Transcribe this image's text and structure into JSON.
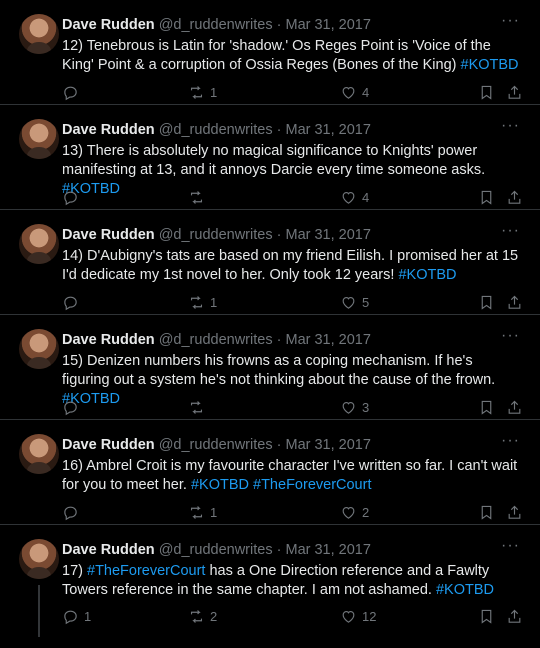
{
  "author": {
    "name": "Dave Rudden",
    "handle": "@d_ruddenwrites",
    "dot": "·",
    "date": "Mar 31, 2017"
  },
  "more_label": "···",
  "tweets": [
    {
      "segments": [
        {
          "t": "12) Tenebrous is Latin for 'shadow.' Os Reges Point is 'Voice of the King' Point & a corruption of Ossia Reges (Bones of the King) "
        },
        {
          "t": "#KOTBD",
          "tag": true
        }
      ],
      "replies": "",
      "retweets": "1",
      "likes": "4"
    },
    {
      "segments": [
        {
          "t": "13) There is absolutely no magical significance to Knights' power manifesting at 13, and it annoys Darcie every time someone asks. "
        },
        {
          "t": "#KOTBD",
          "tag": true
        }
      ],
      "replies": "",
      "retweets": "",
      "likes": "4"
    },
    {
      "segments": [
        {
          "t": "14) D'Aubigny's tats are based on my friend Eilish. I promised her at 15 I'd dedicate my 1st novel to her. Only took 12 years! "
        },
        {
          "t": "#KOTBD",
          "tag": true
        }
      ],
      "replies": "",
      "retweets": "1",
      "likes": "5"
    },
    {
      "segments": [
        {
          "t": "15) Denizen numbers his frowns as a coping mechanism. If he's figuring out a system he's not thinking about the cause of the frown. "
        },
        {
          "t": "#KOTBD",
          "tag": true
        }
      ],
      "replies": "",
      "retweets": "",
      "likes": "3"
    },
    {
      "segments": [
        {
          "t": "16) Ambrel Croit is my favourite character I've written so far. I can't wait for you to meet her. "
        },
        {
          "t": "#KOTBD",
          "tag": true
        },
        {
          "t": " "
        },
        {
          "t": "#TheForeverCourt",
          "tag": true
        }
      ],
      "replies": "",
      "retweets": "1",
      "likes": "2"
    },
    {
      "segments": [
        {
          "t": "17) "
        },
        {
          "t": "#TheForeverCourt",
          "tag": true
        },
        {
          "t": " has a One Direction reference and a Fawlty Towers reference in the same chapter. I am not ashamed. "
        },
        {
          "t": "#KOTBD",
          "tag": true
        }
      ],
      "replies": "1",
      "retweets": "2",
      "likes": "12"
    }
  ]
}
